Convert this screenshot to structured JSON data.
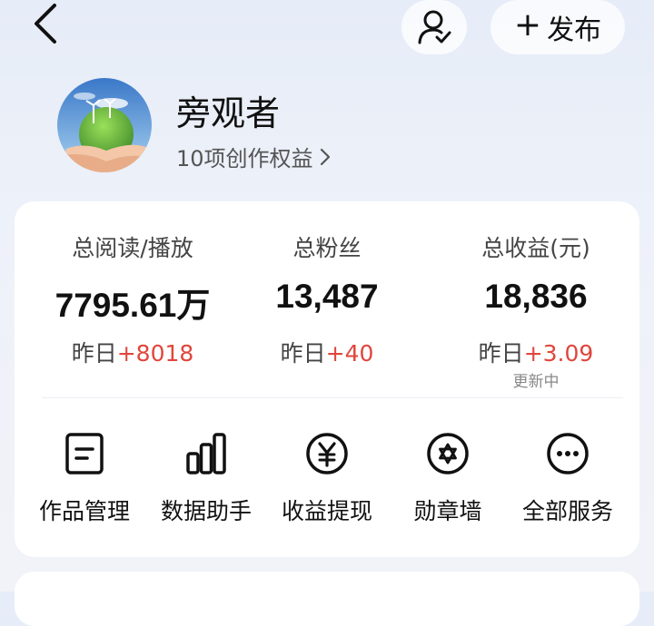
{
  "header": {
    "publish_label": "发布"
  },
  "profile": {
    "username": "旁观者",
    "benefits_label": "10项创作权益"
  },
  "stats": [
    {
      "label": "总阅读/播放",
      "value": "7795.61万",
      "delta_prefix": "昨日",
      "delta": "+8018",
      "sub": ""
    },
    {
      "label": "总粉丝",
      "value": "13,487",
      "delta_prefix": "昨日",
      "delta": "+40",
      "sub": ""
    },
    {
      "label": "总收益(元)",
      "value": "18,836",
      "delta_prefix": "昨日",
      "delta": "+3.09",
      "sub": "更新中"
    }
  ],
  "services": [
    {
      "label": "作品管理",
      "icon": "document-icon"
    },
    {
      "label": "数据助手",
      "icon": "bar-chart-icon"
    },
    {
      "label": "收益提现",
      "icon": "yen-icon"
    },
    {
      "label": "勋章墙",
      "icon": "medal-icon"
    },
    {
      "label": "全部服务",
      "icon": "more-icon"
    }
  ],
  "colors": {
    "accent_delta": "#e0463c",
    "background": "#e9eef8",
    "card": "#ffffff"
  }
}
